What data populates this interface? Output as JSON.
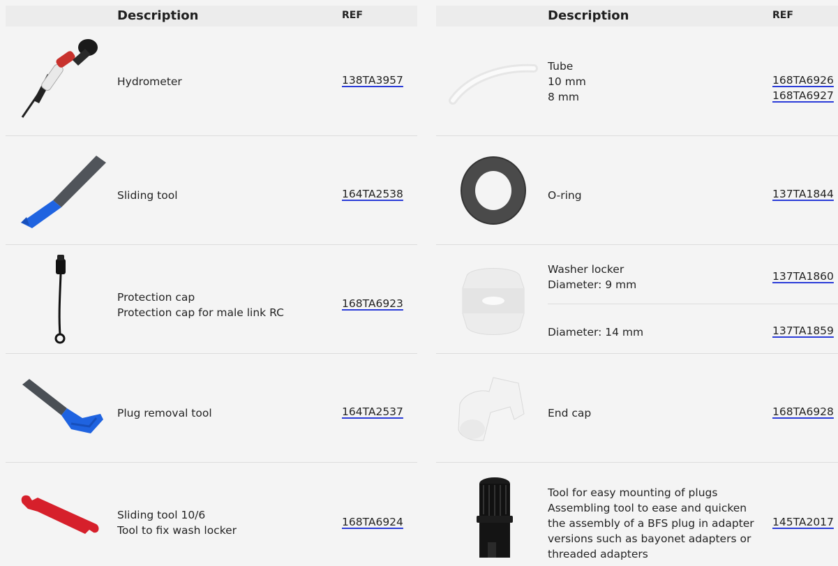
{
  "left": {
    "header": {
      "description": "Description",
      "ref": "REF"
    },
    "rows": [
      {
        "lines": [
          "Hydrometer"
        ],
        "ref": "138TA3957"
      },
      {
        "lines": [
          "Sliding tool"
        ],
        "ref": "164TA2538"
      },
      {
        "lines": [
          "Protection cap",
          "Protection cap for male link RC"
        ],
        "ref": "168TA6923"
      },
      {
        "lines": [
          "Plug removal tool"
        ],
        "ref": "164TA2537"
      },
      {
        "lines": [
          "Sliding tool 10/6",
          "Tool to fix wash locker"
        ],
        "ref": "168TA6924"
      }
    ]
  },
  "right": {
    "header": {
      "description": "Description",
      "ref": "REF"
    },
    "rows": [
      {
        "lines": [
          "Tube",
          "10 mm",
          "8 mm"
        ],
        "refs": [
          "168TA6926",
          "168TA6927"
        ]
      },
      {
        "lines": [
          "O-ring"
        ],
        "ref": "137TA1844"
      },
      {
        "lines": [
          "Washer locker",
          "Diameter: 9 mm"
        ],
        "ref": "137TA1860",
        "sub": {
          "lines": [
            "Diameter: 14 mm"
          ],
          "ref": "137TA1859"
        }
      },
      {
        "lines": [
          "End cap"
        ],
        "ref": "168TA6928"
      },
      {
        "lines": [
          "Tool for easy mounting of plugs",
          "Assembling tool to ease and quicken",
          "the assembly of a BFS plug in adapter",
          "versions such as bayonet adapters or",
          "threaded adapters"
        ],
        "ref": "145TA2017"
      }
    ]
  },
  "colors": {
    "link_underline": "#2a3bd8",
    "header_bg": "#ececec",
    "page_bg": "#f4f4f4"
  },
  "icons": [
    "hydrometer-icon",
    "sliding-tool-icon",
    "protection-cap-icon",
    "plug-removal-tool-icon",
    "wash-locker-tool-icon",
    "tube-icon",
    "o-ring-icon",
    "washer-locker-icon",
    "end-cap-icon",
    "plug-mounting-tool-icon"
  ]
}
